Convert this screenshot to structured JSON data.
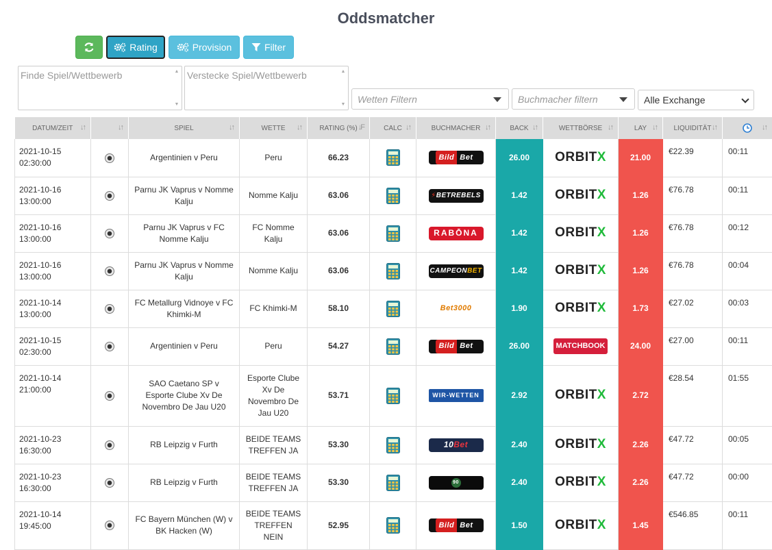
{
  "page": {
    "title": "Oddsmatcher"
  },
  "toolbar": {
    "refresh_icon": "refresh-icon",
    "rating_label": "Rating",
    "provision_label": "Provision",
    "filter_label": "Filter"
  },
  "filters": {
    "find_placeholder": "Finde Spiel/Wettbewerb",
    "hide_placeholder": "Verstecke Spiel/Wettbewerb",
    "bets_placeholder": "Wetten Filtern",
    "bookmaker_placeholder": "Buchmacher filtern",
    "exchange_selected": "Alle Exchange"
  },
  "table": {
    "headers": [
      "DATUM/ZEIT",
      "",
      "SPIEL",
      "WETTE",
      "RATING (%)",
      "CALC",
      "BUCHMACHER",
      "BACK",
      "WETTBÖRSE",
      "LAY",
      "LIQUIDITÄT",
      ""
    ],
    "rows": [
      {
        "date": "2021-10-15",
        "time": "02:30:00",
        "match": "Argentinien v Peru",
        "bet": "Peru",
        "rating": "66.23",
        "bookmaker": "Bild Bet",
        "bm_style": "bild",
        "back": "26.00",
        "exchange": "ORBITX",
        "lay": "21.00",
        "liquidity": "€22.39",
        "age": "00:11"
      },
      {
        "date": "2021-10-16",
        "time": "13:00:00",
        "match": "Parnu JK Vaprus v Nomme Kalju",
        "bet": "Nomme Kalju",
        "rating": "63.06",
        "bookmaker": "BETREBELS",
        "bm_style": "betrebels",
        "back": "1.42",
        "exchange": "ORBITX",
        "lay": "1.26",
        "liquidity": "€76.78",
        "age": "00:11"
      },
      {
        "date": "2021-10-16",
        "time": "13:00:00",
        "match": "Parnu JK Vaprus v FC Nomme Kalju",
        "bet": "FC Nomme Kalju",
        "rating": "63.06",
        "bookmaker": "RABONA",
        "bm_style": "rabona",
        "back": "1.42",
        "exchange": "ORBITX",
        "lay": "1.26",
        "liquidity": "€76.78",
        "age": "00:12"
      },
      {
        "date": "2021-10-16",
        "time": "13:00:00",
        "match": "Parnu JK Vaprus v Nomme Kalju",
        "bet": "Nomme Kalju",
        "rating": "63.06",
        "bookmaker": "CAMPEONBET",
        "bm_style": "campeon",
        "back": "1.42",
        "exchange": "ORBITX",
        "lay": "1.26",
        "liquidity": "€76.78",
        "age": "00:04"
      },
      {
        "date": "2021-10-14",
        "time": "13:00:00",
        "match": "FC Metallurg Vidnoye v FC Khimki-M",
        "bet": "FC Khimki-M",
        "rating": "58.10",
        "bookmaker": "Bet3000",
        "bm_style": "bet3000",
        "back": "1.90",
        "exchange": "ORBITX",
        "lay": "1.73",
        "liquidity": "€27.02",
        "age": "00:03"
      },
      {
        "date": "2021-10-15",
        "time": "02:30:00",
        "match": "Argentinien v Peru",
        "bet": "Peru",
        "rating": "54.27",
        "bookmaker": "Bild Bet",
        "bm_style": "bild",
        "back": "26.00",
        "exchange": "MATCHBOOK",
        "lay": "24.00",
        "liquidity": "€27.00",
        "age": "00:11"
      },
      {
        "date": "2021-10-14",
        "time": "21:00:00",
        "match": "SAO Caetano SP v Esporte Clube Xv De Novembro De Jau U20",
        "bet": "Esporte Clube Xv De Novembro De Jau U20",
        "rating": "53.71",
        "bookmaker": "WIR-WETTEN",
        "bm_style": "wir",
        "back": "2.92",
        "exchange": "ORBITX",
        "lay": "2.72",
        "liquidity": "€28.54",
        "age": "01:55"
      },
      {
        "date": "2021-10-23",
        "time": "16:30:00",
        "match": "RB Leipzig v Furth",
        "bet": "BEIDE TEAMS TREFFEN JA",
        "rating": "53.30",
        "bookmaker": "10Bet",
        "bm_style": "tenbet",
        "back": "2.40",
        "exchange": "ORBITX",
        "lay": "2.26",
        "liquidity": "€47.72",
        "age": "00:05"
      },
      {
        "date": "2021-10-23",
        "time": "16:30:00",
        "match": "RB Leipzig v Furth",
        "bet": "BEIDE TEAMS TREFFEN JA",
        "rating": "53.30",
        "bookmaker": "90",
        "bm_style": "b90",
        "back": "2.40",
        "exchange": "ORBITX",
        "lay": "2.26",
        "liquidity": "€47.72",
        "age": "00:00"
      },
      {
        "date": "2021-10-14",
        "time": "19:45:00",
        "match": "FC Bayern München (W) v BK Hacken (W)",
        "bet": "BEIDE TEAMS TREFFEN NEIN",
        "rating": "52.95",
        "bookmaker": "Bild Bet",
        "bm_style": "bild",
        "back": "1.50",
        "exchange": "ORBITX",
        "lay": "1.45",
        "liquidity": "€546.85",
        "age": "00:11"
      }
    ]
  },
  "colors": {
    "back": "#1aa8a8",
    "lay": "#f0544d",
    "refresh": "#5cb85c",
    "info": "#5bc0de"
  }
}
